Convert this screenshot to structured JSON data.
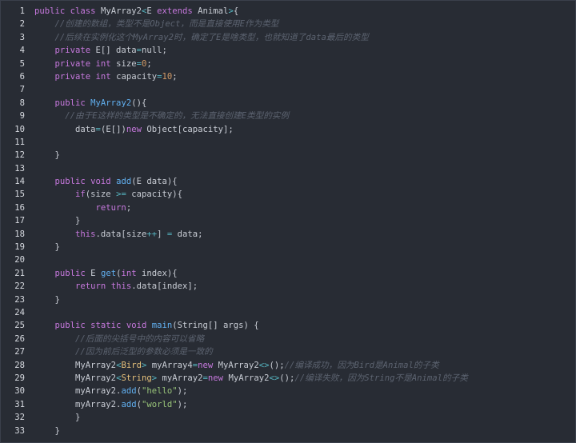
{
  "editor": {
    "lines": [
      {
        "n": "1",
        "parts": [
          [
            "kw",
            "public "
          ],
          [
            "kw",
            "class "
          ],
          [
            "plain",
            "MyArray2"
          ],
          [
            "op",
            "<"
          ],
          [
            "plain",
            "E "
          ],
          [
            "kw",
            "extends "
          ],
          [
            "plain",
            "Animal"
          ],
          [
            "op",
            ">"
          ],
          [
            "plain",
            "{"
          ]
        ]
      },
      {
        "n": "2",
        "parts": [
          [
            "plain",
            "    "
          ],
          [
            "cmt",
            "//创建的数组，类型不是Object，而是直接使用E作为类型"
          ]
        ]
      },
      {
        "n": "3",
        "parts": [
          [
            "plain",
            "    "
          ],
          [
            "cmt",
            "//后续在实例化这个MyArray2时，确定了E是啥类型，也就知道了data最后的类型"
          ]
        ]
      },
      {
        "n": "4",
        "parts": [
          [
            "plain",
            "    "
          ],
          [
            "kw",
            "private "
          ],
          [
            "plain",
            "E[] data"
          ],
          [
            "op",
            "="
          ],
          [
            "plain",
            "null;"
          ]
        ]
      },
      {
        "n": "5",
        "parts": [
          [
            "plain",
            "    "
          ],
          [
            "kw",
            "private "
          ],
          [
            "kw",
            "int "
          ],
          [
            "plain",
            "size"
          ],
          [
            "op",
            "="
          ],
          [
            "num",
            "0"
          ],
          [
            "plain",
            ";"
          ]
        ]
      },
      {
        "n": "6",
        "parts": [
          [
            "plain",
            "    "
          ],
          [
            "kw",
            "private "
          ],
          [
            "kw",
            "int "
          ],
          [
            "plain",
            "capacity"
          ],
          [
            "op",
            "="
          ],
          [
            "num",
            "10"
          ],
          [
            "plain",
            ";"
          ]
        ]
      },
      {
        "n": "7",
        "parts": []
      },
      {
        "n": "8",
        "parts": [
          [
            "plain",
            "    "
          ],
          [
            "kw",
            "public "
          ],
          [
            "fn",
            "MyArray2"
          ],
          [
            "plain",
            "(){"
          ]
        ]
      },
      {
        "n": "9",
        "parts": [
          [
            "plain",
            "      "
          ],
          [
            "cmt",
            "//由于E这样的类型是不确定的，无法直接创建E类型的实例"
          ]
        ]
      },
      {
        "n": "10",
        "parts": [
          [
            "plain",
            "        data"
          ],
          [
            "op",
            "="
          ],
          [
            "plain",
            "(E[])"
          ],
          [
            "kw",
            "new "
          ],
          [
            "plain",
            "Object[capacity];"
          ]
        ]
      },
      {
        "n": "11",
        "parts": []
      },
      {
        "n": "12",
        "parts": [
          [
            "plain",
            "    }"
          ]
        ]
      },
      {
        "n": "13",
        "parts": []
      },
      {
        "n": "14",
        "parts": [
          [
            "plain",
            "    "
          ],
          [
            "kw",
            "public "
          ],
          [
            "kw",
            "void "
          ],
          [
            "fn",
            "add"
          ],
          [
            "plain",
            "(E data){"
          ]
        ]
      },
      {
        "n": "15",
        "parts": [
          [
            "plain",
            "        "
          ],
          [
            "kw",
            "if"
          ],
          [
            "plain",
            "(size "
          ],
          [
            "op",
            ">="
          ],
          [
            "plain",
            " capacity){"
          ]
        ]
      },
      {
        "n": "16",
        "parts": [
          [
            "plain",
            "            "
          ],
          [
            "kw",
            "return"
          ],
          [
            "plain",
            ";"
          ]
        ]
      },
      {
        "n": "17",
        "parts": [
          [
            "plain",
            "        }"
          ]
        ]
      },
      {
        "n": "18",
        "parts": [
          [
            "plain",
            "        "
          ],
          [
            "kw",
            "this"
          ],
          [
            "plain",
            ".data[size"
          ],
          [
            "op",
            "++"
          ],
          [
            "plain",
            "] "
          ],
          [
            "op",
            "="
          ],
          [
            "plain",
            " data;"
          ]
        ]
      },
      {
        "n": "19",
        "parts": [
          [
            "plain",
            "    }"
          ]
        ]
      },
      {
        "n": "20",
        "parts": []
      },
      {
        "n": "21",
        "parts": [
          [
            "plain",
            "    "
          ],
          [
            "kw",
            "public "
          ],
          [
            "plain",
            "E "
          ],
          [
            "fn",
            "get"
          ],
          [
            "plain",
            "("
          ],
          [
            "kw",
            "int "
          ],
          [
            "plain",
            "index){"
          ]
        ]
      },
      {
        "n": "22",
        "parts": [
          [
            "plain",
            "        "
          ],
          [
            "kw",
            "return "
          ],
          [
            "kw",
            "this"
          ],
          [
            "plain",
            ".data[index];"
          ]
        ]
      },
      {
        "n": "23",
        "parts": [
          [
            "plain",
            "    }"
          ]
        ]
      },
      {
        "n": "24",
        "parts": []
      },
      {
        "n": "25",
        "parts": [
          [
            "plain",
            "    "
          ],
          [
            "kw",
            "public "
          ],
          [
            "kw",
            "static "
          ],
          [
            "kw",
            "void "
          ],
          [
            "fn",
            "main"
          ],
          [
            "plain",
            "(String[] args) {"
          ]
        ]
      },
      {
        "n": "26",
        "parts": [
          [
            "plain",
            "        "
          ],
          [
            "cmt",
            "//后面的尖括号中的内容可以省略"
          ]
        ]
      },
      {
        "n": "27",
        "parts": [
          [
            "plain",
            "        "
          ],
          [
            "cmt",
            "//因为前后泛型的参数必须是一致的"
          ]
        ]
      },
      {
        "n": "28",
        "parts": [
          [
            "plain",
            "        MyArray2"
          ],
          [
            "op",
            "<"
          ],
          [
            "gen",
            "Bird"
          ],
          [
            "op",
            "> "
          ],
          [
            "plain",
            "myArray4"
          ],
          [
            "op",
            "="
          ],
          [
            "kw",
            "new "
          ],
          [
            "plain",
            "MyArray2"
          ],
          [
            "op",
            "<>"
          ],
          [
            "plain",
            "();"
          ],
          [
            "cmt",
            "//编译成功，因为Bird是Animal的子类"
          ]
        ]
      },
      {
        "n": "29",
        "parts": [
          [
            "plain",
            "        MyArray2"
          ],
          [
            "op",
            "<"
          ],
          [
            "gen",
            "String"
          ],
          [
            "op",
            "> "
          ],
          [
            "plain",
            "myArray2"
          ],
          [
            "op",
            "="
          ],
          [
            "kw",
            "new "
          ],
          [
            "plain",
            "MyArray2"
          ],
          [
            "op",
            "<>"
          ],
          [
            "plain",
            "();"
          ],
          [
            "cmt",
            "//编译失败，因为String不是Animal的子类"
          ]
        ]
      },
      {
        "n": "30",
        "parts": [
          [
            "plain",
            "        myArray2."
          ],
          [
            "fn",
            "add"
          ],
          [
            "plain",
            "("
          ],
          [
            "str",
            "\"hello\""
          ],
          [
            "plain",
            ");"
          ]
        ]
      },
      {
        "n": "31",
        "parts": [
          [
            "plain",
            "        myArray2."
          ],
          [
            "fn",
            "add"
          ],
          [
            "plain",
            "("
          ],
          [
            "str",
            "\"world\""
          ],
          [
            "plain",
            ");"
          ]
        ]
      },
      {
        "n": "32",
        "parts": [
          [
            "plain",
            "        }"
          ]
        ]
      },
      {
        "n": "33",
        "parts": [
          [
            "plain",
            "    }"
          ]
        ]
      }
    ]
  }
}
